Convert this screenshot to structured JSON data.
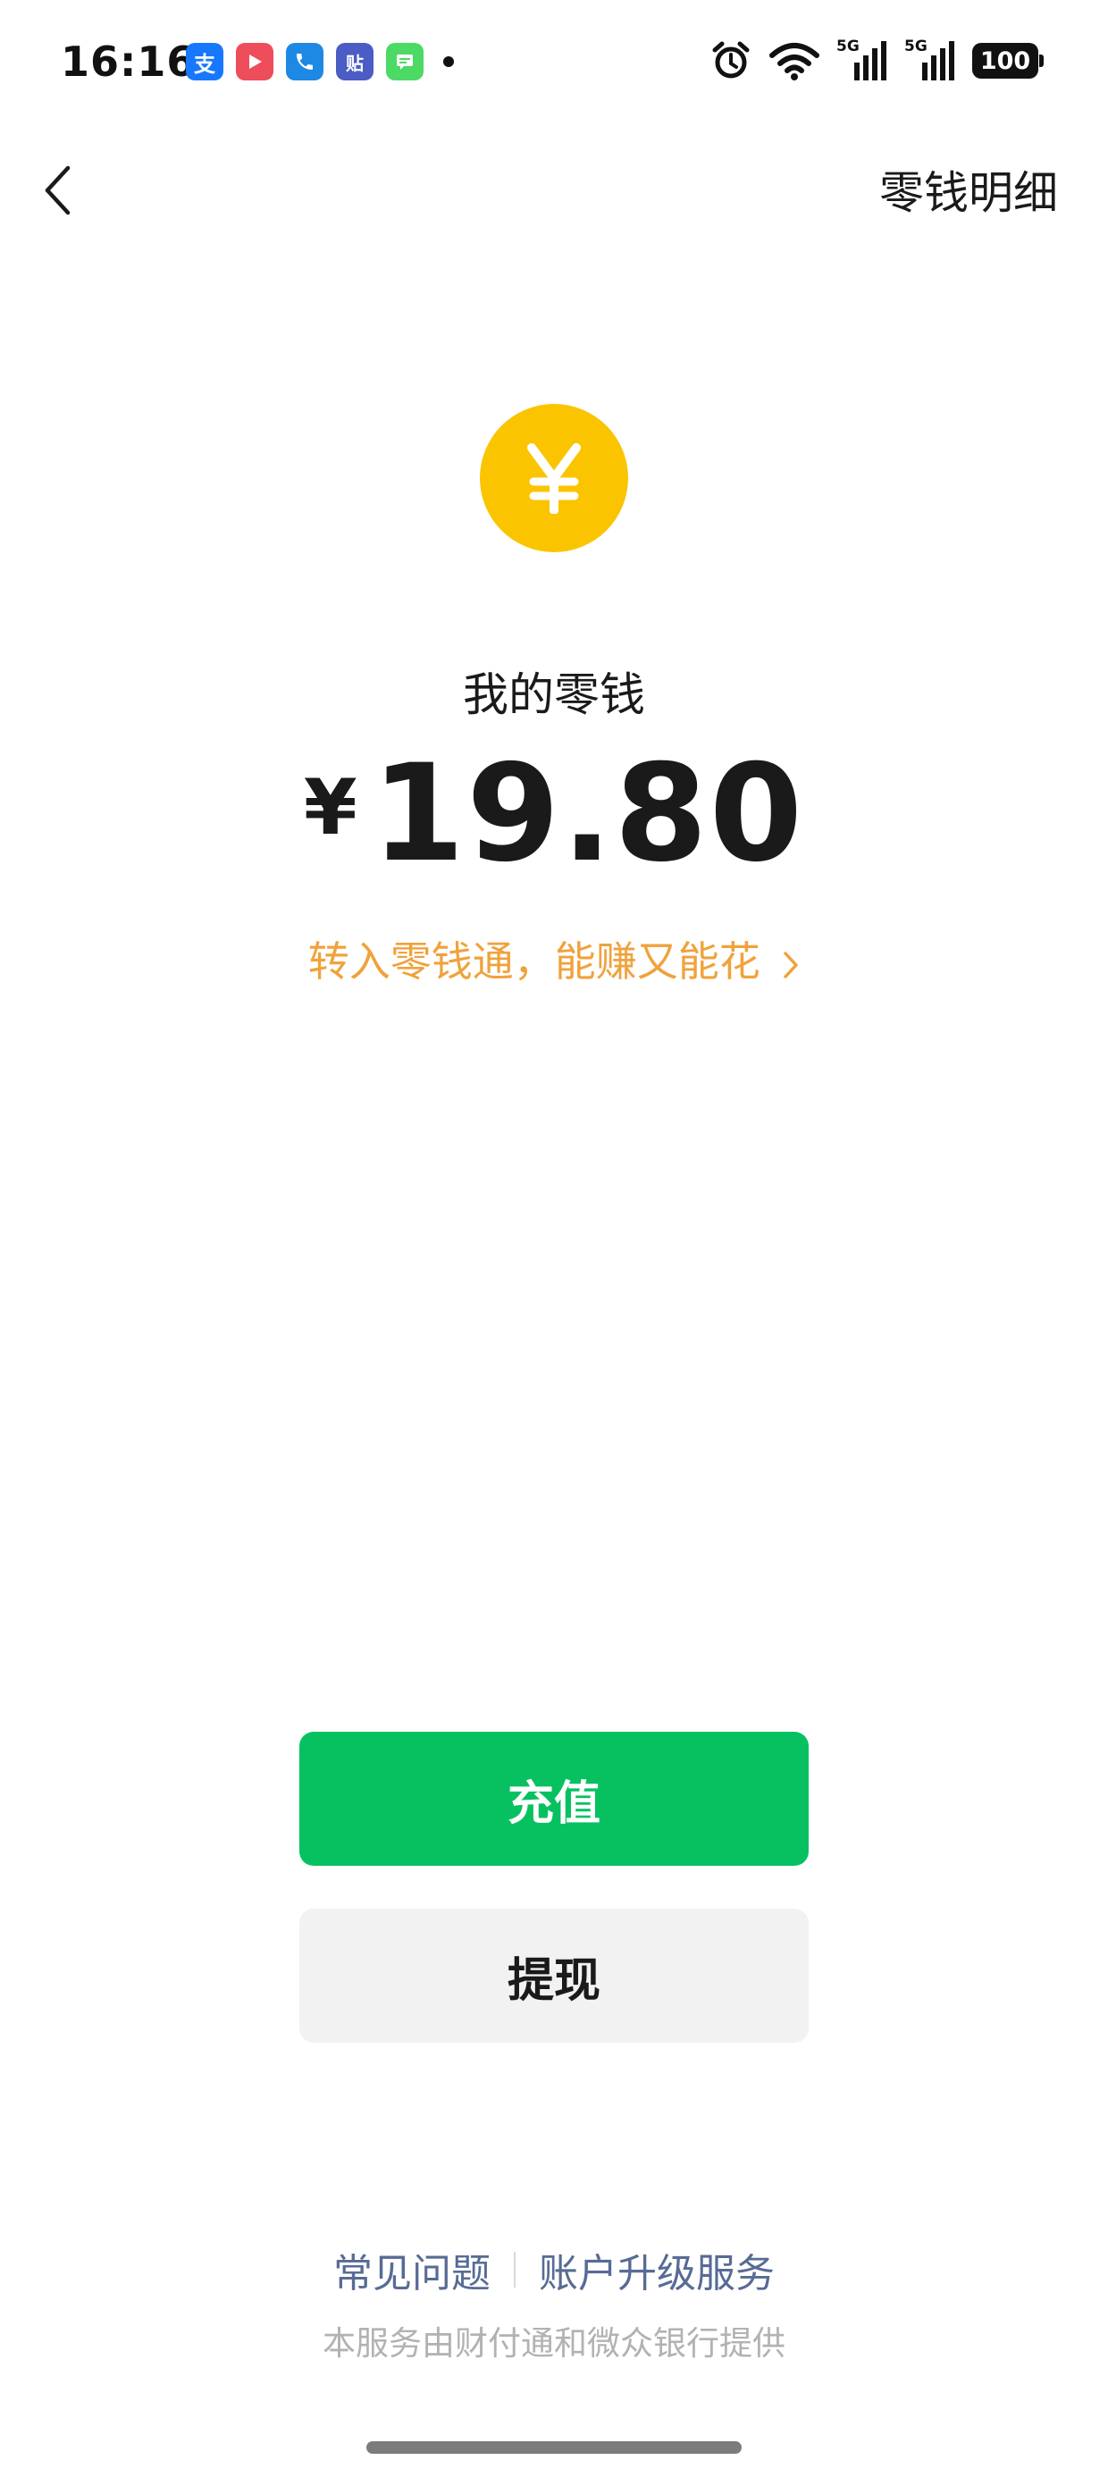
{
  "status_bar": {
    "time": "16:16",
    "notification_apps": [
      {
        "name": "alipay-icon",
        "glyph": "支",
        "color": "#1677ff"
      },
      {
        "name": "video-app-icon",
        "glyph": "▶",
        "color": "#ee4d5b"
      },
      {
        "name": "phone-app-icon",
        "glyph": "✆",
        "color": "#1e88e5"
      },
      {
        "name": "tieba-icon",
        "glyph": "贴",
        "color": "#4b5cc4"
      },
      {
        "name": "messages-icon",
        "glyph": "▤",
        "color": "#4cd964"
      }
    ],
    "signal_1_label": "5G",
    "signal_2_label": "5G",
    "battery": "100"
  },
  "nav": {
    "right_label": "零钱明细"
  },
  "wallet": {
    "coin_glyph": "¥",
    "coin_color": "#fbc400",
    "label": "我的零钱",
    "currency": "¥",
    "amount": "19.80",
    "promo_text": "转入零钱通，能赚又能花",
    "promo_color": "#f0a23b"
  },
  "actions": {
    "recharge_label": "充值",
    "recharge_color": "#07c160",
    "withdraw_label": "提现"
  },
  "footer": {
    "faq_label": "常见问题",
    "upgrade_label": "账户升级服务",
    "link_color": "#576b95",
    "provider_note": "本服务由财付通和微众银行提供"
  }
}
